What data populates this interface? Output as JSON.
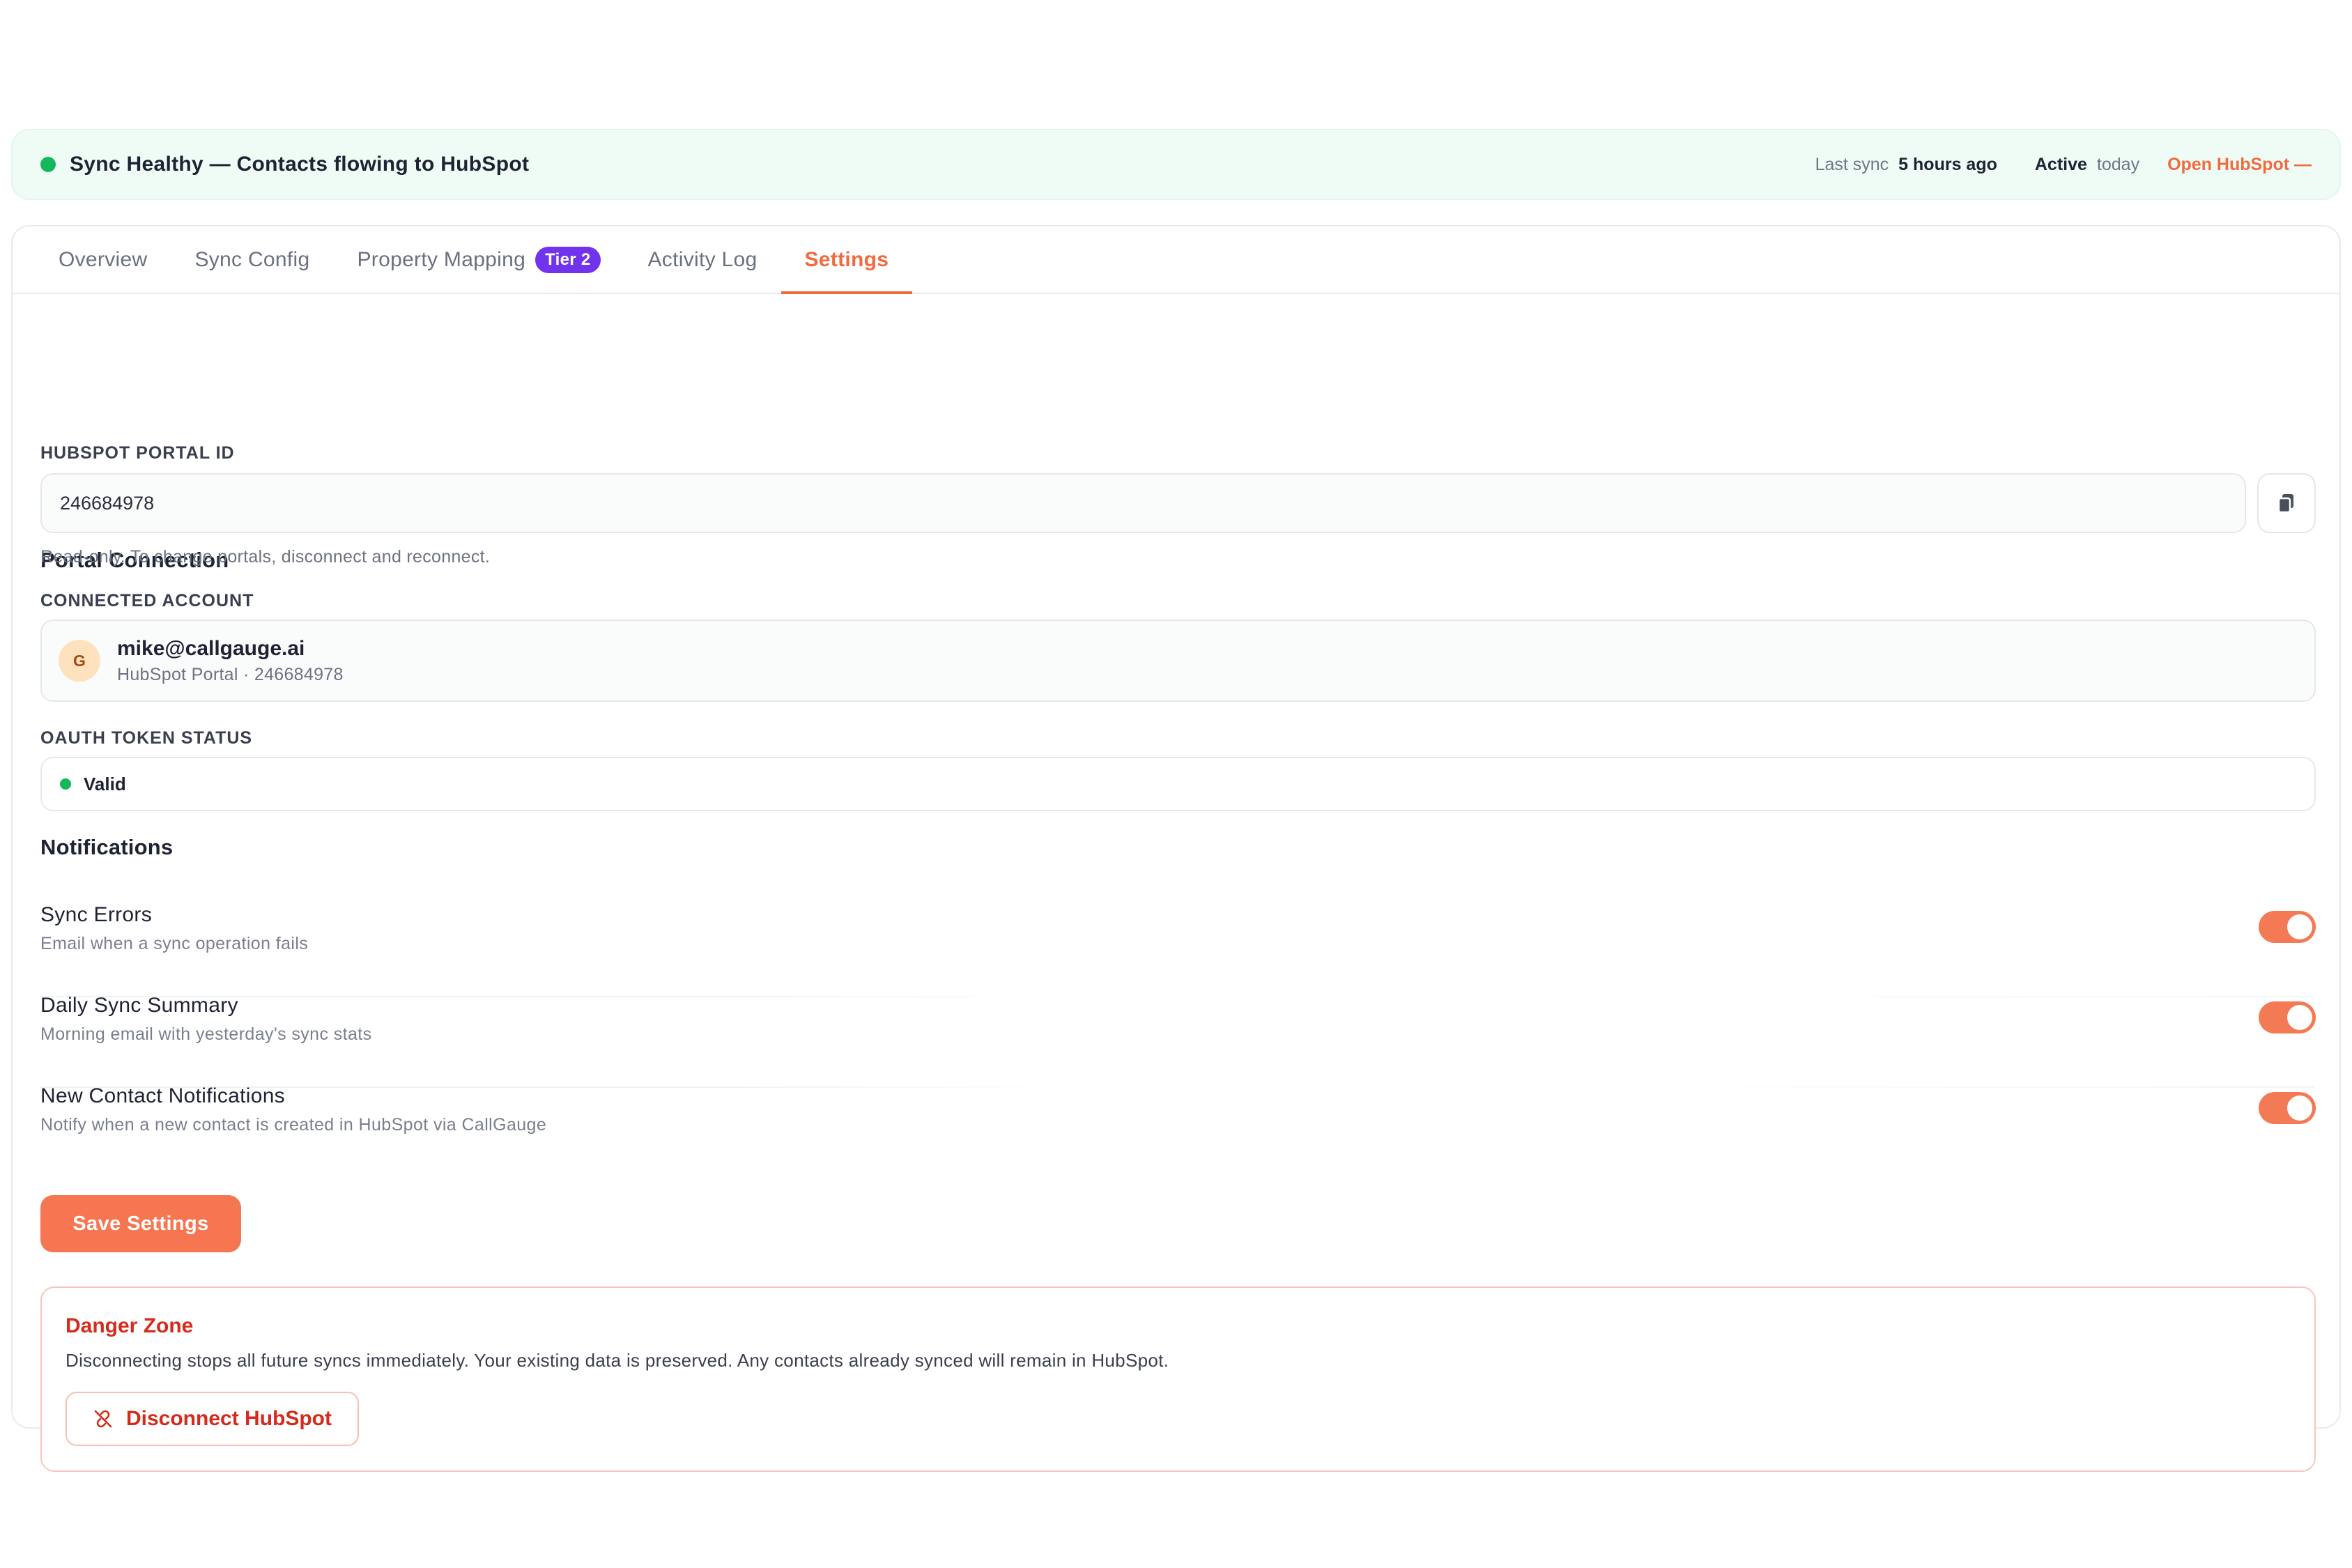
{
  "status_bar": {
    "text": "Sync Healthy — Contacts flowing to HubSpot",
    "last_sync_label": "Last sync",
    "last_sync_value": "5 hours ago",
    "active_label": "Active",
    "active_value": "today",
    "open_link": "Open HubSpot —"
  },
  "tabs": [
    {
      "label": "Overview"
    },
    {
      "label": "Sync Config"
    },
    {
      "label": "Property Mapping",
      "badge": "Tier 2"
    },
    {
      "label": "Activity Log"
    },
    {
      "label": "Settings",
      "active": true
    }
  ],
  "portal_connection": {
    "title": "Portal Connection",
    "portal_id_label": "HUBSPOT PORTAL ID",
    "portal_id_value": "246684978",
    "portal_id_hint": "Read-only. To change portals, disconnect and reconnect.",
    "account_label": "CONNECTED ACCOUNT",
    "account_avatar": "G",
    "account_email": "mike@callgauge.ai",
    "account_sub": "HubSpot Portal · 246684978",
    "token_label": "OAUTH TOKEN STATUS",
    "token_value": "Valid"
  },
  "notifications": {
    "title": "Notifications",
    "items": [
      {
        "title": "Sync Errors",
        "desc": "Email when a sync operation fails",
        "enabled": true
      },
      {
        "title": "Daily Sync Summary",
        "desc": "Morning email with yesterday's sync stats",
        "enabled": true
      },
      {
        "title": "New Contact Notifications",
        "desc": "Notify when a new contact is created in HubSpot via CallGauge",
        "enabled": true
      }
    ]
  },
  "save_label": "Save Settings",
  "danger_zone": {
    "title": "Danger Zone",
    "text": "Disconnecting stops all future syncs immediately. Your existing data is preserved. Any contacts already synced will remain in HubSpot.",
    "button": "Disconnect HubSpot"
  },
  "colors": {
    "accent": "#f26a3f",
    "success": "#14b85a",
    "badge": "#7233ec",
    "danger": "#d42b1c"
  },
  "icons": {
    "status": "green-dot-icon",
    "copy": "copy-icon",
    "disconnect": "unlink-icon"
  }
}
